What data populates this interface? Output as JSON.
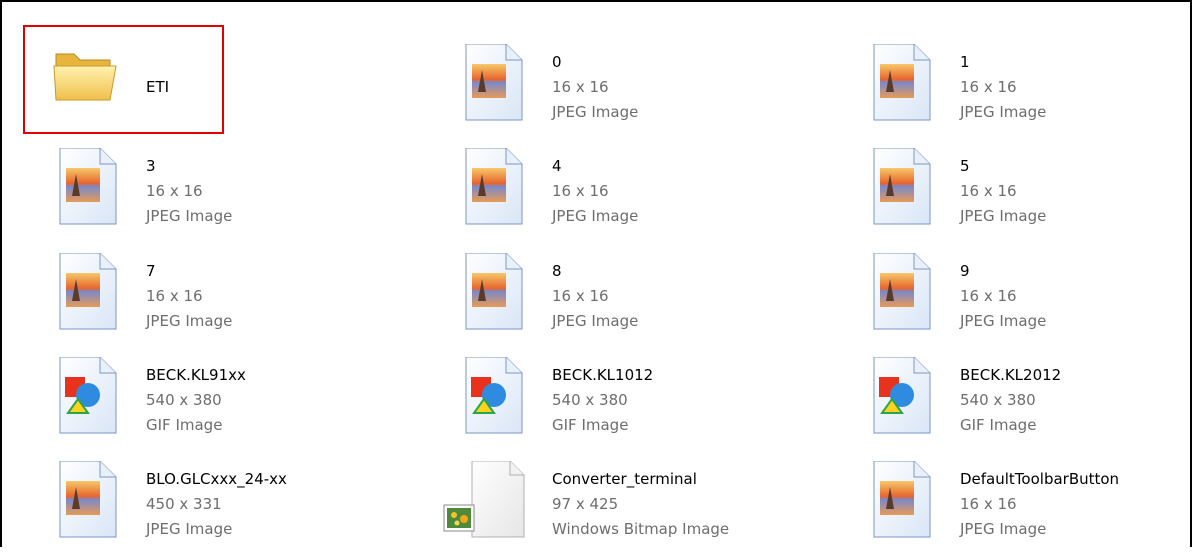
{
  "items": [
    {
      "name": "ETI",
      "dims": "",
      "type": "",
      "icon": "folder-icon"
    },
    {
      "name": "0",
      "dims": "16 x 16",
      "type": "JPEG Image",
      "icon": "jpeg-file-icon"
    },
    {
      "name": "1",
      "dims": "16 x 16",
      "type": "JPEG Image",
      "icon": "jpeg-file-icon"
    },
    {
      "name": "3",
      "dims": "16 x 16",
      "type": "JPEG Image",
      "icon": "jpeg-file-icon"
    },
    {
      "name": "4",
      "dims": "16 x 16",
      "type": "JPEG Image",
      "icon": "jpeg-file-icon"
    },
    {
      "name": "5",
      "dims": "16 x 16",
      "type": "JPEG Image",
      "icon": "jpeg-file-icon"
    },
    {
      "name": "7",
      "dims": "16 x 16",
      "type": "JPEG Image",
      "icon": "jpeg-file-icon"
    },
    {
      "name": "8",
      "dims": "16 x 16",
      "type": "JPEG Image",
      "icon": "jpeg-file-icon"
    },
    {
      "name": "9",
      "dims": "16 x 16",
      "type": "JPEG Image",
      "icon": "jpeg-file-icon"
    },
    {
      "name": "BECK.KL91xx",
      "dims": "540 x 380",
      "type": "GIF Image",
      "icon": "gif-file-icon"
    },
    {
      "name": "BECK.KL1012",
      "dims": "540 x 380",
      "type": "GIF Image",
      "icon": "gif-file-icon"
    },
    {
      "name": "BECK.KL2012",
      "dims": "540 x 380",
      "type": "GIF Image",
      "icon": "gif-file-icon"
    },
    {
      "name": "BLO.GLCxxx_24-xx",
      "dims": "450 x 331",
      "type": "JPEG Image",
      "icon": "jpeg-file-icon"
    },
    {
      "name": "Converter_terminal",
      "dims": "97 x 425",
      "type": "Windows Bitmap Image",
      "icon": "bitmap-file-icon"
    },
    {
      "name": "DefaultToolbarButton",
      "dims": "16 x 16",
      "type": "JPEG Image",
      "icon": "jpeg-file-icon"
    }
  ],
  "selection_color": "#e00000"
}
